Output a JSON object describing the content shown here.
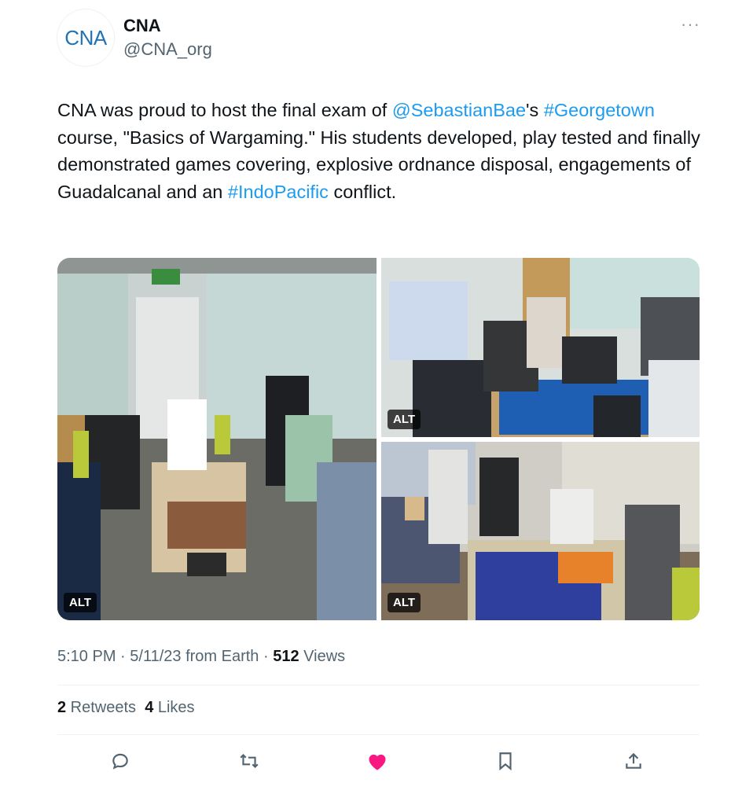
{
  "author": {
    "avatar_text": "CNA",
    "name": "CNA",
    "handle": "@CNA_org"
  },
  "more_label": "···",
  "tweet": {
    "t1": "CNA was proud to host the final exam of ",
    "mention": "@SebastianBae",
    "t2": "'s ",
    "hashtag1": "#Georgetown",
    "t3": " course, \"Basics of Wargaming.\" His students developed, play tested and finally demonstrated games covering, explosive ordnance disposal, engagements of Guadalcanal and an ",
    "hashtag2": "#IndoPacific",
    "t4": " conflict."
  },
  "media": {
    "alt_label": "ALT",
    "images": [
      {
        "description": "photo-left"
      },
      {
        "description": "photo-top-right"
      },
      {
        "description": "photo-bottom-right"
      }
    ]
  },
  "meta": {
    "time": "5:10 PM",
    "sep1": " · ",
    "date": "5/11/23",
    "source": " from Earth",
    "sep2": " · ",
    "views_count": "512",
    "views_label": " Views"
  },
  "stats": {
    "retweets_count": "2",
    "retweets_label": " Retweets",
    "likes_count": "4",
    "likes_label": " Likes"
  },
  "colors": {
    "link": "#1d9bf0",
    "like_active": "#f91880",
    "muted": "#536471"
  },
  "actions": [
    "reply-icon",
    "retweet-icon",
    "like-icon",
    "bookmark-icon",
    "share-icon"
  ]
}
